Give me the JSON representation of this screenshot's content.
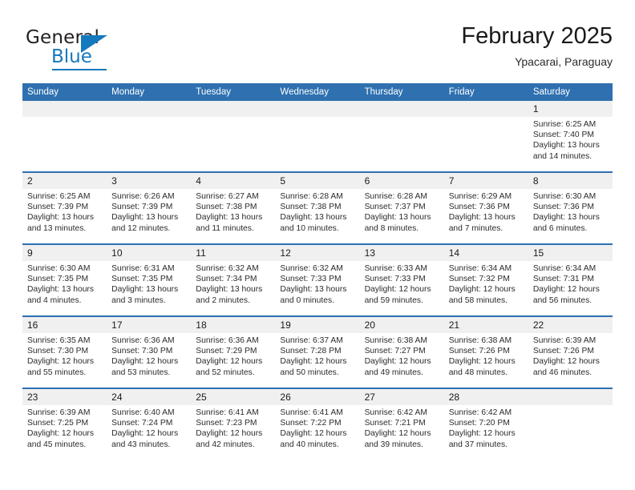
{
  "logo": {
    "word_one": "General",
    "word_two": "Blue",
    "triangle_icon": "triangle-icon",
    "brand_color": "#1479bd"
  },
  "header": {
    "month_title": "February 2025",
    "location": "Ypacarai, Paraguay"
  },
  "theme": {
    "header_blue": "#2e70b0",
    "daynum_band": "#f0f0f0",
    "text": "#2b2b2b"
  },
  "calendar": {
    "weekday_headers": [
      "Sunday",
      "Monday",
      "Tuesday",
      "Wednesday",
      "Thursday",
      "Friday",
      "Saturday"
    ],
    "weeks": [
      [
        {
          "day": "",
          "empty": true
        },
        {
          "day": "",
          "empty": true
        },
        {
          "day": "",
          "empty": true
        },
        {
          "day": "",
          "empty": true
        },
        {
          "day": "",
          "empty": true
        },
        {
          "day": "",
          "empty": true
        },
        {
          "day": "1",
          "sunrise": "Sunrise: 6:25 AM",
          "sunset": "Sunset: 7:40 PM",
          "daylight": "Daylight: 13 hours and 14 minutes."
        }
      ],
      [
        {
          "day": "2",
          "sunrise": "Sunrise: 6:25 AM",
          "sunset": "Sunset: 7:39 PM",
          "daylight": "Daylight: 13 hours and 13 minutes."
        },
        {
          "day": "3",
          "sunrise": "Sunrise: 6:26 AM",
          "sunset": "Sunset: 7:39 PM",
          "daylight": "Daylight: 13 hours and 12 minutes."
        },
        {
          "day": "4",
          "sunrise": "Sunrise: 6:27 AM",
          "sunset": "Sunset: 7:38 PM",
          "daylight": "Daylight: 13 hours and 11 minutes."
        },
        {
          "day": "5",
          "sunrise": "Sunrise: 6:28 AM",
          "sunset": "Sunset: 7:38 PM",
          "daylight": "Daylight: 13 hours and 10 minutes."
        },
        {
          "day": "6",
          "sunrise": "Sunrise: 6:28 AM",
          "sunset": "Sunset: 7:37 PM",
          "daylight": "Daylight: 13 hours and 8 minutes."
        },
        {
          "day": "7",
          "sunrise": "Sunrise: 6:29 AM",
          "sunset": "Sunset: 7:36 PM",
          "daylight": "Daylight: 13 hours and 7 minutes."
        },
        {
          "day": "8",
          "sunrise": "Sunrise: 6:30 AM",
          "sunset": "Sunset: 7:36 PM",
          "daylight": "Daylight: 13 hours and 6 minutes."
        }
      ],
      [
        {
          "day": "9",
          "sunrise": "Sunrise: 6:30 AM",
          "sunset": "Sunset: 7:35 PM",
          "daylight": "Daylight: 13 hours and 4 minutes."
        },
        {
          "day": "10",
          "sunrise": "Sunrise: 6:31 AM",
          "sunset": "Sunset: 7:35 PM",
          "daylight": "Daylight: 13 hours and 3 minutes."
        },
        {
          "day": "11",
          "sunrise": "Sunrise: 6:32 AM",
          "sunset": "Sunset: 7:34 PM",
          "daylight": "Daylight: 13 hours and 2 minutes."
        },
        {
          "day": "12",
          "sunrise": "Sunrise: 6:32 AM",
          "sunset": "Sunset: 7:33 PM",
          "daylight": "Daylight: 13 hours and 0 minutes."
        },
        {
          "day": "13",
          "sunrise": "Sunrise: 6:33 AM",
          "sunset": "Sunset: 7:33 PM",
          "daylight": "Daylight: 12 hours and 59 minutes."
        },
        {
          "day": "14",
          "sunrise": "Sunrise: 6:34 AM",
          "sunset": "Sunset: 7:32 PM",
          "daylight": "Daylight: 12 hours and 58 minutes."
        },
        {
          "day": "15",
          "sunrise": "Sunrise: 6:34 AM",
          "sunset": "Sunset: 7:31 PM",
          "daylight": "Daylight: 12 hours and 56 minutes."
        }
      ],
      [
        {
          "day": "16",
          "sunrise": "Sunrise: 6:35 AM",
          "sunset": "Sunset: 7:30 PM",
          "daylight": "Daylight: 12 hours and 55 minutes."
        },
        {
          "day": "17",
          "sunrise": "Sunrise: 6:36 AM",
          "sunset": "Sunset: 7:30 PM",
          "daylight": "Daylight: 12 hours and 53 minutes."
        },
        {
          "day": "18",
          "sunrise": "Sunrise: 6:36 AM",
          "sunset": "Sunset: 7:29 PM",
          "daylight": "Daylight: 12 hours and 52 minutes."
        },
        {
          "day": "19",
          "sunrise": "Sunrise: 6:37 AM",
          "sunset": "Sunset: 7:28 PM",
          "daylight": "Daylight: 12 hours and 50 minutes."
        },
        {
          "day": "20",
          "sunrise": "Sunrise: 6:38 AM",
          "sunset": "Sunset: 7:27 PM",
          "daylight": "Daylight: 12 hours and 49 minutes."
        },
        {
          "day": "21",
          "sunrise": "Sunrise: 6:38 AM",
          "sunset": "Sunset: 7:26 PM",
          "daylight": "Daylight: 12 hours and 48 minutes."
        },
        {
          "day": "22",
          "sunrise": "Sunrise: 6:39 AM",
          "sunset": "Sunset: 7:26 PM",
          "daylight": "Daylight: 12 hours and 46 minutes."
        }
      ],
      [
        {
          "day": "23",
          "sunrise": "Sunrise: 6:39 AM",
          "sunset": "Sunset: 7:25 PM",
          "daylight": "Daylight: 12 hours and 45 minutes."
        },
        {
          "day": "24",
          "sunrise": "Sunrise: 6:40 AM",
          "sunset": "Sunset: 7:24 PM",
          "daylight": "Daylight: 12 hours and 43 minutes."
        },
        {
          "day": "25",
          "sunrise": "Sunrise: 6:41 AM",
          "sunset": "Sunset: 7:23 PM",
          "daylight": "Daylight: 12 hours and 42 minutes."
        },
        {
          "day": "26",
          "sunrise": "Sunrise: 6:41 AM",
          "sunset": "Sunset: 7:22 PM",
          "daylight": "Daylight: 12 hours and 40 minutes."
        },
        {
          "day": "27",
          "sunrise": "Sunrise: 6:42 AM",
          "sunset": "Sunset: 7:21 PM",
          "daylight": "Daylight: 12 hours and 39 minutes."
        },
        {
          "day": "28",
          "sunrise": "Sunrise: 6:42 AM",
          "sunset": "Sunset: 7:20 PM",
          "daylight": "Daylight: 12 hours and 37 minutes."
        },
        {
          "day": "",
          "empty": true
        }
      ]
    ]
  }
}
